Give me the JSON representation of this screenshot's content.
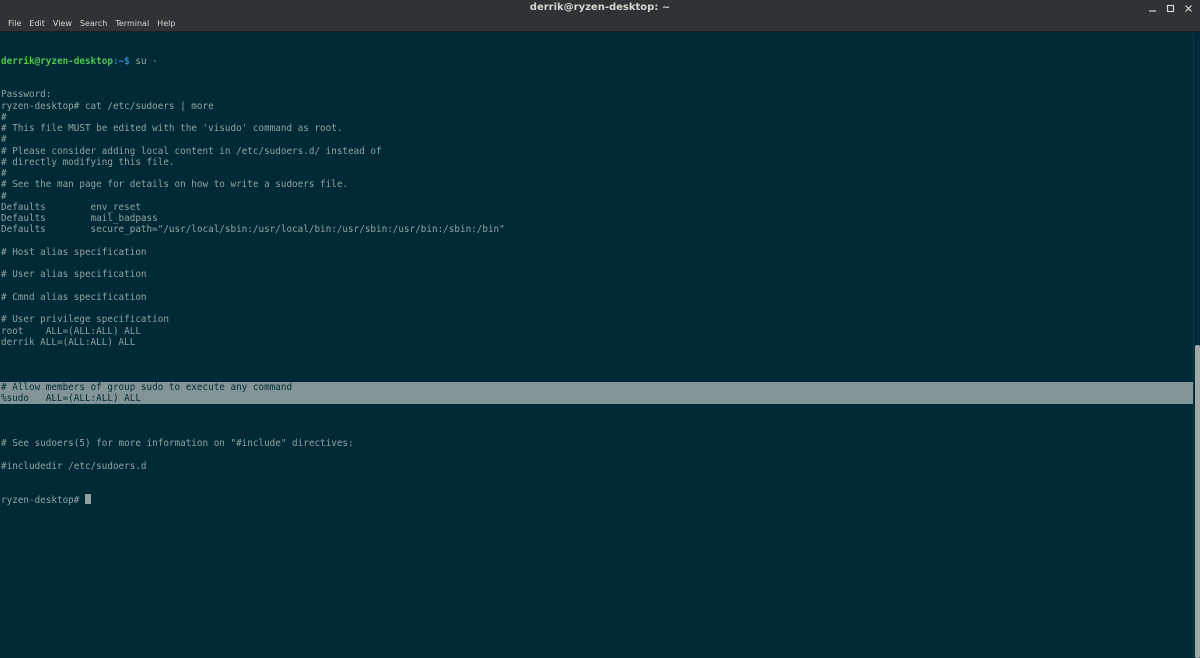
{
  "window": {
    "title": "derrik@ryzen-desktop: ~"
  },
  "menu": {
    "items": [
      "File",
      "Edit",
      "View",
      "Search",
      "Terminal",
      "Help"
    ]
  },
  "terminal": {
    "prompt_user": "derrik@ryzen-desktop",
    "prompt_path": ":~$",
    "first_command": " su -",
    "lines": [
      "Password:",
      "ryzen-desktop# cat /etc/sudoers | more",
      "#",
      "# This file MUST be edited with the 'visudo' command as root.",
      "#",
      "# Please consider adding local content in /etc/sudoers.d/ instead of",
      "# directly modifying this file.",
      "#",
      "# See the man page for details on how to write a sudoers file.",
      "#",
      "Defaults        env_reset",
      "Defaults        mail_badpass",
      "Defaults        secure_path=\"/usr/local/sbin:/usr/local/bin:/usr/sbin:/usr/bin:/sbin:/bin\"",
      "",
      "# Host alias specification",
      "",
      "# User alias specification",
      "",
      "# Cmnd alias specification",
      "",
      "# User privilege specification",
      "root    ALL=(ALL:ALL) ALL",
      "derrik ALL=(ALL:ALL) ALL",
      ""
    ],
    "highlighted_lines": [
      "# Allow members of group sudo to execute any command",
      "%sudo   ALL=(ALL:ALL) ALL"
    ],
    "trailing_lines": [
      "",
      "# See sudoers(5) for more information on \"#include\" directives:",
      "",
      "#includedir /etc/sudoers.d"
    ],
    "final_prompt": "ryzen-desktop# "
  }
}
